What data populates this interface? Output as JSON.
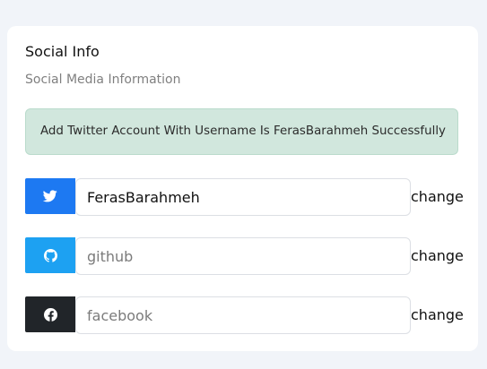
{
  "card": {
    "title": "Social Info",
    "subtitle": "Social Media Information"
  },
  "alert": {
    "message": "Add Twitter Account With Username Is FerasBarahmeh Successfully"
  },
  "social": {
    "twitter": {
      "icon": "twitter-icon",
      "color": "#1d79f2",
      "value": "FerasBarahmeh",
      "placeholder": "",
      "change_label": "change"
    },
    "github": {
      "icon": "github-icon",
      "color": "#1da1f2",
      "value": "",
      "placeholder": "github",
      "change_label": "change"
    },
    "facebook": {
      "icon": "facebook-icon",
      "color": "#212529",
      "value": "",
      "placeholder": "facebook",
      "change_label": "change"
    }
  }
}
